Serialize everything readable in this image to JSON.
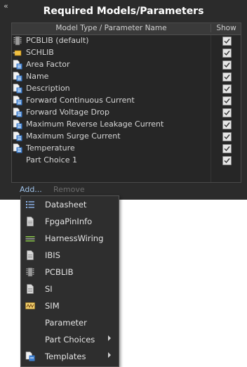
{
  "panel": {
    "title": "Required Models/Parameters",
    "collapse_glyph": "«",
    "columns": {
      "type": "Model Type / Parameter Name",
      "show": "Show"
    },
    "rows": [
      {
        "label": "PCBLIB (default)",
        "icon": "pcb-chip-icon",
        "show": true
      },
      {
        "label": "SCHLIB",
        "icon": "schematic-symbol-icon",
        "show": true
      },
      {
        "label": "Area Factor",
        "icon": "parameter-document-icon",
        "show": true
      },
      {
        "label": "Name",
        "icon": "parameter-document-icon",
        "show": true
      },
      {
        "label": "Description",
        "icon": "parameter-document-icon",
        "show": true
      },
      {
        "label": "Forward Continuous Current",
        "icon": "parameter-document-icon",
        "show": true
      },
      {
        "label": "Forward Voltage Drop",
        "icon": "parameter-document-icon",
        "show": true
      },
      {
        "label": "Maximum Reverse Leakage Current",
        "icon": "parameter-document-icon",
        "show": true
      },
      {
        "label": "Maximum Surge Current",
        "icon": "parameter-document-icon",
        "show": true
      },
      {
        "label": "Temperature",
        "icon": "parameter-document-icon",
        "show": true
      },
      {
        "label": "Part Choice 1",
        "icon": "",
        "show": true
      }
    ],
    "add_label": "Add...",
    "remove_label": "Remove"
  },
  "menu": {
    "items": [
      {
        "label": "Datasheet",
        "icon": "datasheet-list-icon"
      },
      {
        "label": "FpgaPinInfo",
        "icon": "document-icon"
      },
      {
        "label": "HarnessWiring",
        "icon": "harness-wiring-icon"
      },
      {
        "label": "IBIS",
        "icon": "document-icon"
      },
      {
        "label": "PCBLIB",
        "icon": "pcb-chip-icon"
      },
      {
        "label": "SI",
        "icon": "document-icon"
      },
      {
        "label": "SIM",
        "icon": "sim-icon"
      },
      {
        "label": "Parameter",
        "icon": ""
      },
      {
        "label": "Part Choices",
        "icon": "",
        "submenu": true
      },
      {
        "label": "Templates",
        "icon": "templates-icon",
        "submenu": true
      }
    ]
  },
  "colors": {
    "panel_bg": "#2b2b2b",
    "link": "#9fc2e8",
    "disabled": "#6c6c6c"
  }
}
